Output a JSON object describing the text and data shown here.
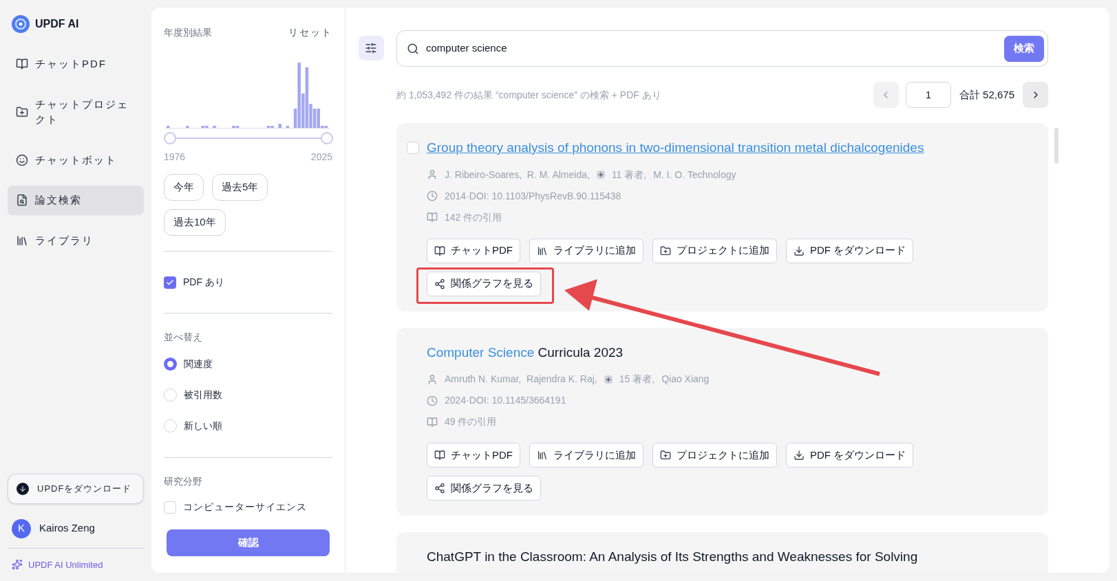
{
  "app": {
    "name": "UPDF AI"
  },
  "nav": [
    {
      "kind": "chat-pdf",
      "label": "チャットPDF",
      "selected": false
    },
    {
      "kind": "project",
      "label": "チャットプロジェクト",
      "selected": false
    },
    {
      "kind": "bot",
      "label": "チャットボット",
      "selected": false
    },
    {
      "kind": "search",
      "label": "論文検索",
      "selected": true
    },
    {
      "kind": "library",
      "label": "ライブラリ",
      "selected": false
    }
  ],
  "download_button": "UPDFをダウンロード",
  "user": {
    "initial": "K",
    "name": "Kairos Zeng"
  },
  "plan": "UPDF AI Unlimited",
  "filters": {
    "year_title": "年度別結果",
    "reset": "リセット",
    "year_from": "1976",
    "year_to": "2025",
    "year_handles": [
      {
        "level": 0
      },
      {
        "level": 1
      }
    ],
    "presets": [
      "今年",
      "過去5年",
      "過去10年"
    ],
    "pdf_only": {
      "label": "PDF あり",
      "checked": true
    },
    "sort_title": "並べ替え",
    "sort_options": [
      {
        "label": "関連度",
        "selected": true
      },
      {
        "label": "被引用数",
        "selected": false
      },
      {
        "label": "新しい順",
        "selected": false
      }
    ],
    "field_title": "研究分野",
    "fields": [
      {
        "label": "コンピューターサイエンス",
        "checked": false
      }
    ],
    "confirm": "確認"
  },
  "search": {
    "value": "computer science",
    "button": "検索"
  },
  "results_summary": "約 1,053,492 件の結果 “computer science” の検索 + PDF あり",
  "pagination": {
    "page": "1",
    "total": "合計 52,675"
  },
  "papers": [
    {
      "checked": false,
      "title_parts": [
        {
          "text": "Group theory analysis of phonons in two-dimensional transition metal dichalcogenides",
          "kind": "link"
        }
      ],
      "authors": "J. Ribeiro-Soares,  R. M. Almeida,",
      "more_authors": "11 著者,",
      "last_author": "M. I. O. Technology",
      "doi": "2014·DOI: 10.1103/PhysRevB.90.115438",
      "citations": "142 件の引用",
      "actions": [
        {
          "kind": "chat",
          "label": "チャットPDF"
        },
        {
          "kind": "library",
          "label": "ライブラリに追加"
        },
        {
          "kind": "project",
          "label": "プロジェクトに追加"
        },
        {
          "kind": "download",
          "label": "PDF をダウンロード"
        },
        {
          "kind": "graph",
          "label": "関係グラフを見る"
        }
      ]
    },
    {
      "title_parts": [
        {
          "text": "Computer Science",
          "kind": "match"
        },
        {
          "text": " Curricula 2023",
          "kind": "plain"
        }
      ],
      "authors": "Amruth N. Kumar,  Rajendra K. Raj,",
      "more_authors": "15 著者,",
      "last_author": "Qiao Xiang",
      "doi": "2024·DOI: 10.1145/3664191",
      "citations": "49 件の引用",
      "actions": [
        {
          "kind": "chat",
          "label": "チャットPDF"
        },
        {
          "kind": "library",
          "label": "ライブラリに追加"
        },
        {
          "kind": "project",
          "label": "プロジェクトに追加"
        },
        {
          "kind": "download",
          "label": "PDF をダウンロード"
        },
        {
          "kind": "graph",
          "label": "関係グラフを見る"
        }
      ]
    },
    {
      "title_parts": [
        {
          "text": "ChatGPT in the Classroom: An Analysis of Its Strengths and Weaknesses for Solving",
          "kind": "plain"
        }
      ]
    }
  ],
  "annotations": {
    "highlight_box": {
      "color": "#e5484d"
    },
    "arrow": {
      "color": "#e5484d"
    }
  }
}
